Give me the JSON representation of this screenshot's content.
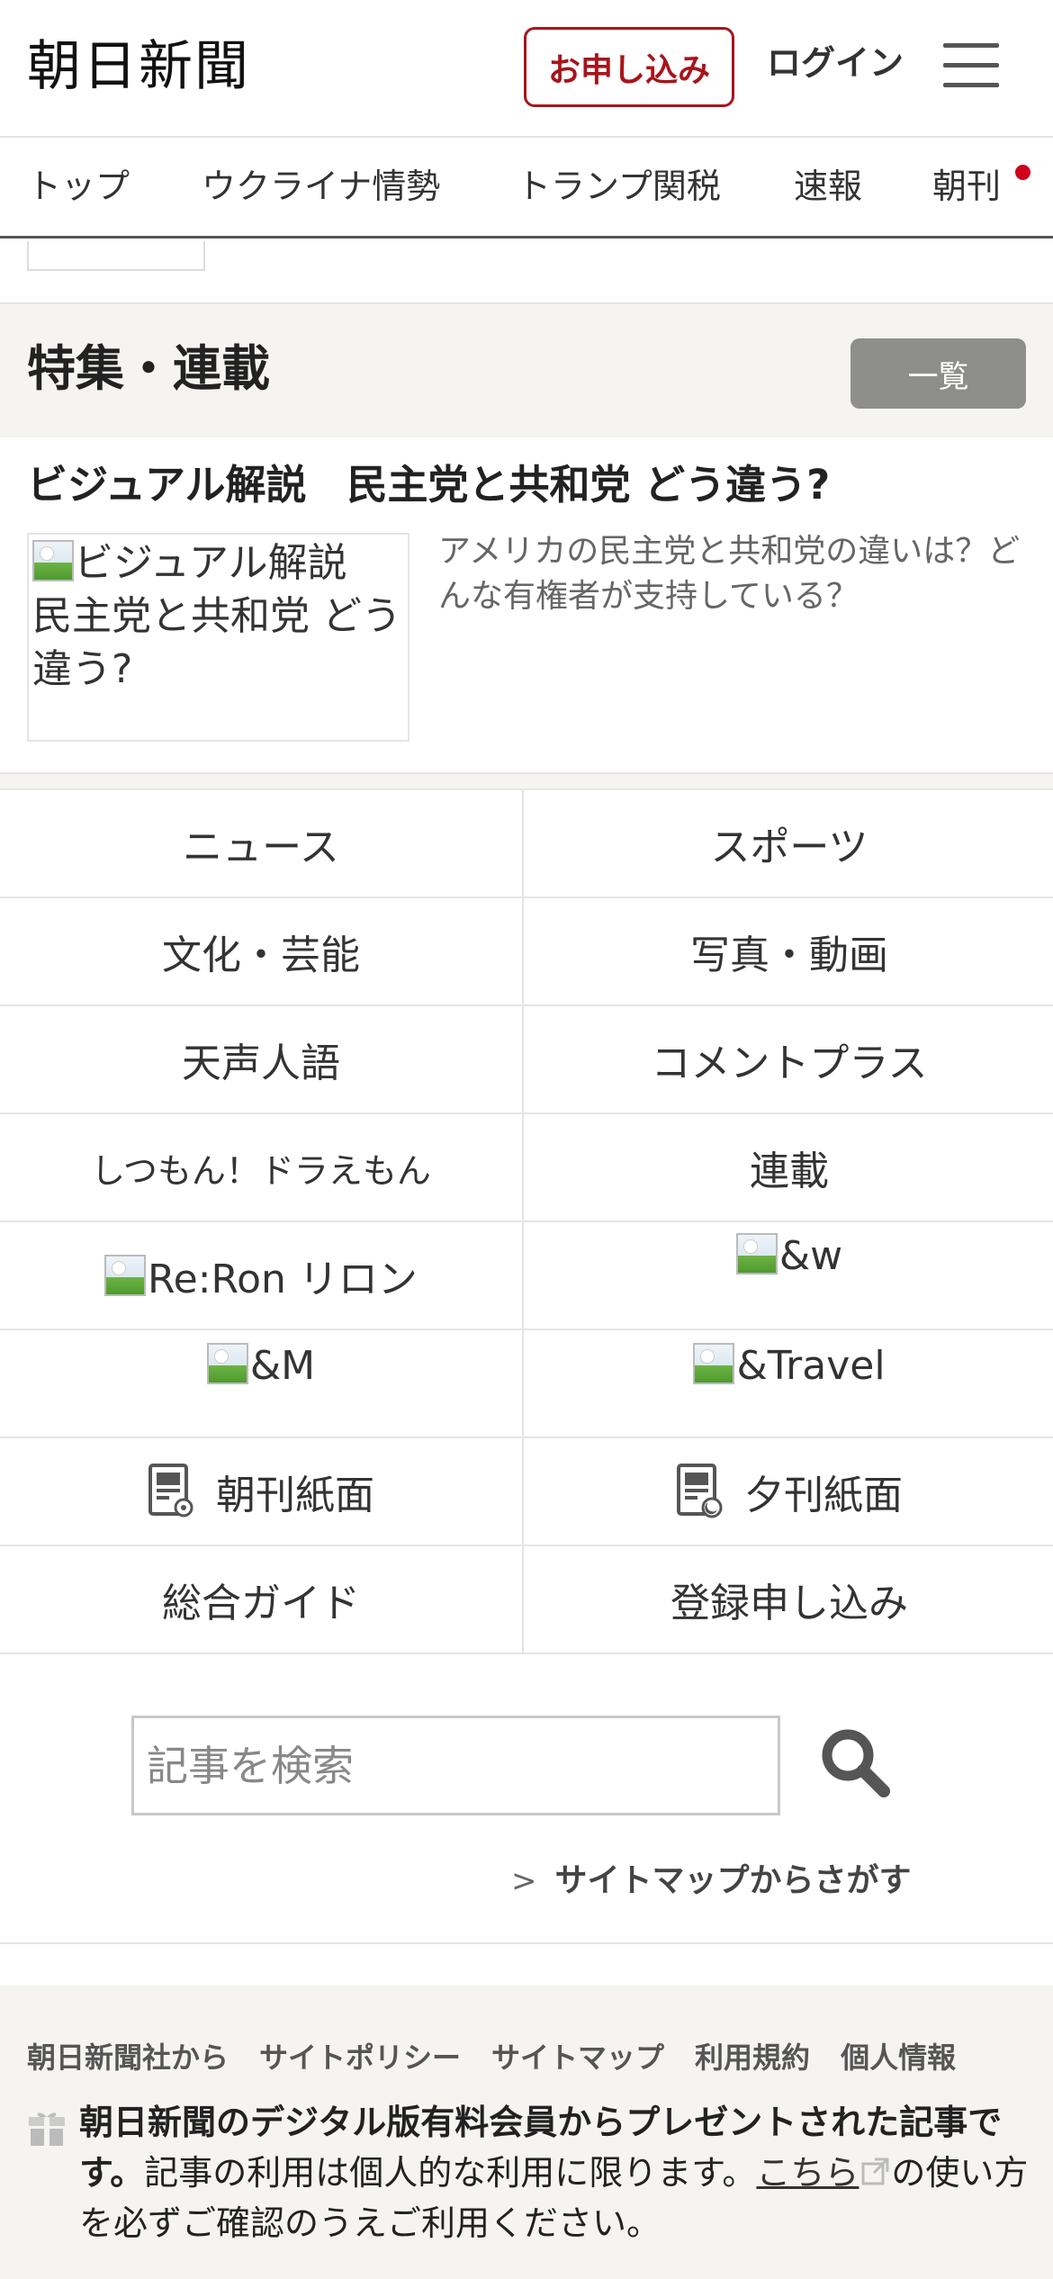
{
  "header": {
    "logo": "朝日新聞",
    "apply_label": "お申し込み",
    "login_label": "ログイン",
    "menu_icon": "hamburger-menu-icon"
  },
  "nav": {
    "items": [
      "トップ",
      "ウクライナ情勢",
      "トランプ関税",
      "速報",
      "朝刊"
    ]
  },
  "feature": {
    "title": "特集・連載",
    "list_label": "一覧",
    "article_title": "ビジュアル解説　民主党と共和党 どう違う?",
    "image_alt": "ビジュアル解説　民主党と共和党 どう違う?",
    "description": "アメリカの民主党と共和党の違いは？どんな有権者が支持している？"
  },
  "grid": {
    "rows": [
      [
        "ニュース",
        "スポーツ"
      ],
      [
        "文化・芸能",
        "写真・動画"
      ],
      [
        "天声人語",
        "コメントプラス"
      ],
      [
        "しつもん！ドラえもん",
        "連載"
      ],
      [
        "Re:Ron リロン",
        "&w"
      ],
      [
        "&M",
        "&Travel"
      ],
      [
        "朝刊紙面",
        "夕刊紙面"
      ],
      [
        "総合ガイド",
        "登録申し込み"
      ]
    ]
  },
  "search": {
    "placeholder": "記事を検索",
    "sitemap_label": "サイトマップからさがす"
  },
  "footer": {
    "links": [
      "朝日新聞社から",
      "サイトポリシー",
      "サイトマップ",
      "利用規約",
      "個人情報"
    ],
    "gift_bold": "朝日新聞のデジタル版有料会員からプレゼントされた記事です。",
    "gift_text_before": "記事の利用は個人的な利用に限ります。",
    "gift_link": "こちら",
    "gift_text_after": "の使い方を必ずご確認のうえご利用ください。"
  },
  "colors": {
    "brand_red": "#a8151c",
    "notification_dot": "#d0021b",
    "section_bg": "#f5f4f0",
    "list_button_bg": "#8e8e8a"
  }
}
